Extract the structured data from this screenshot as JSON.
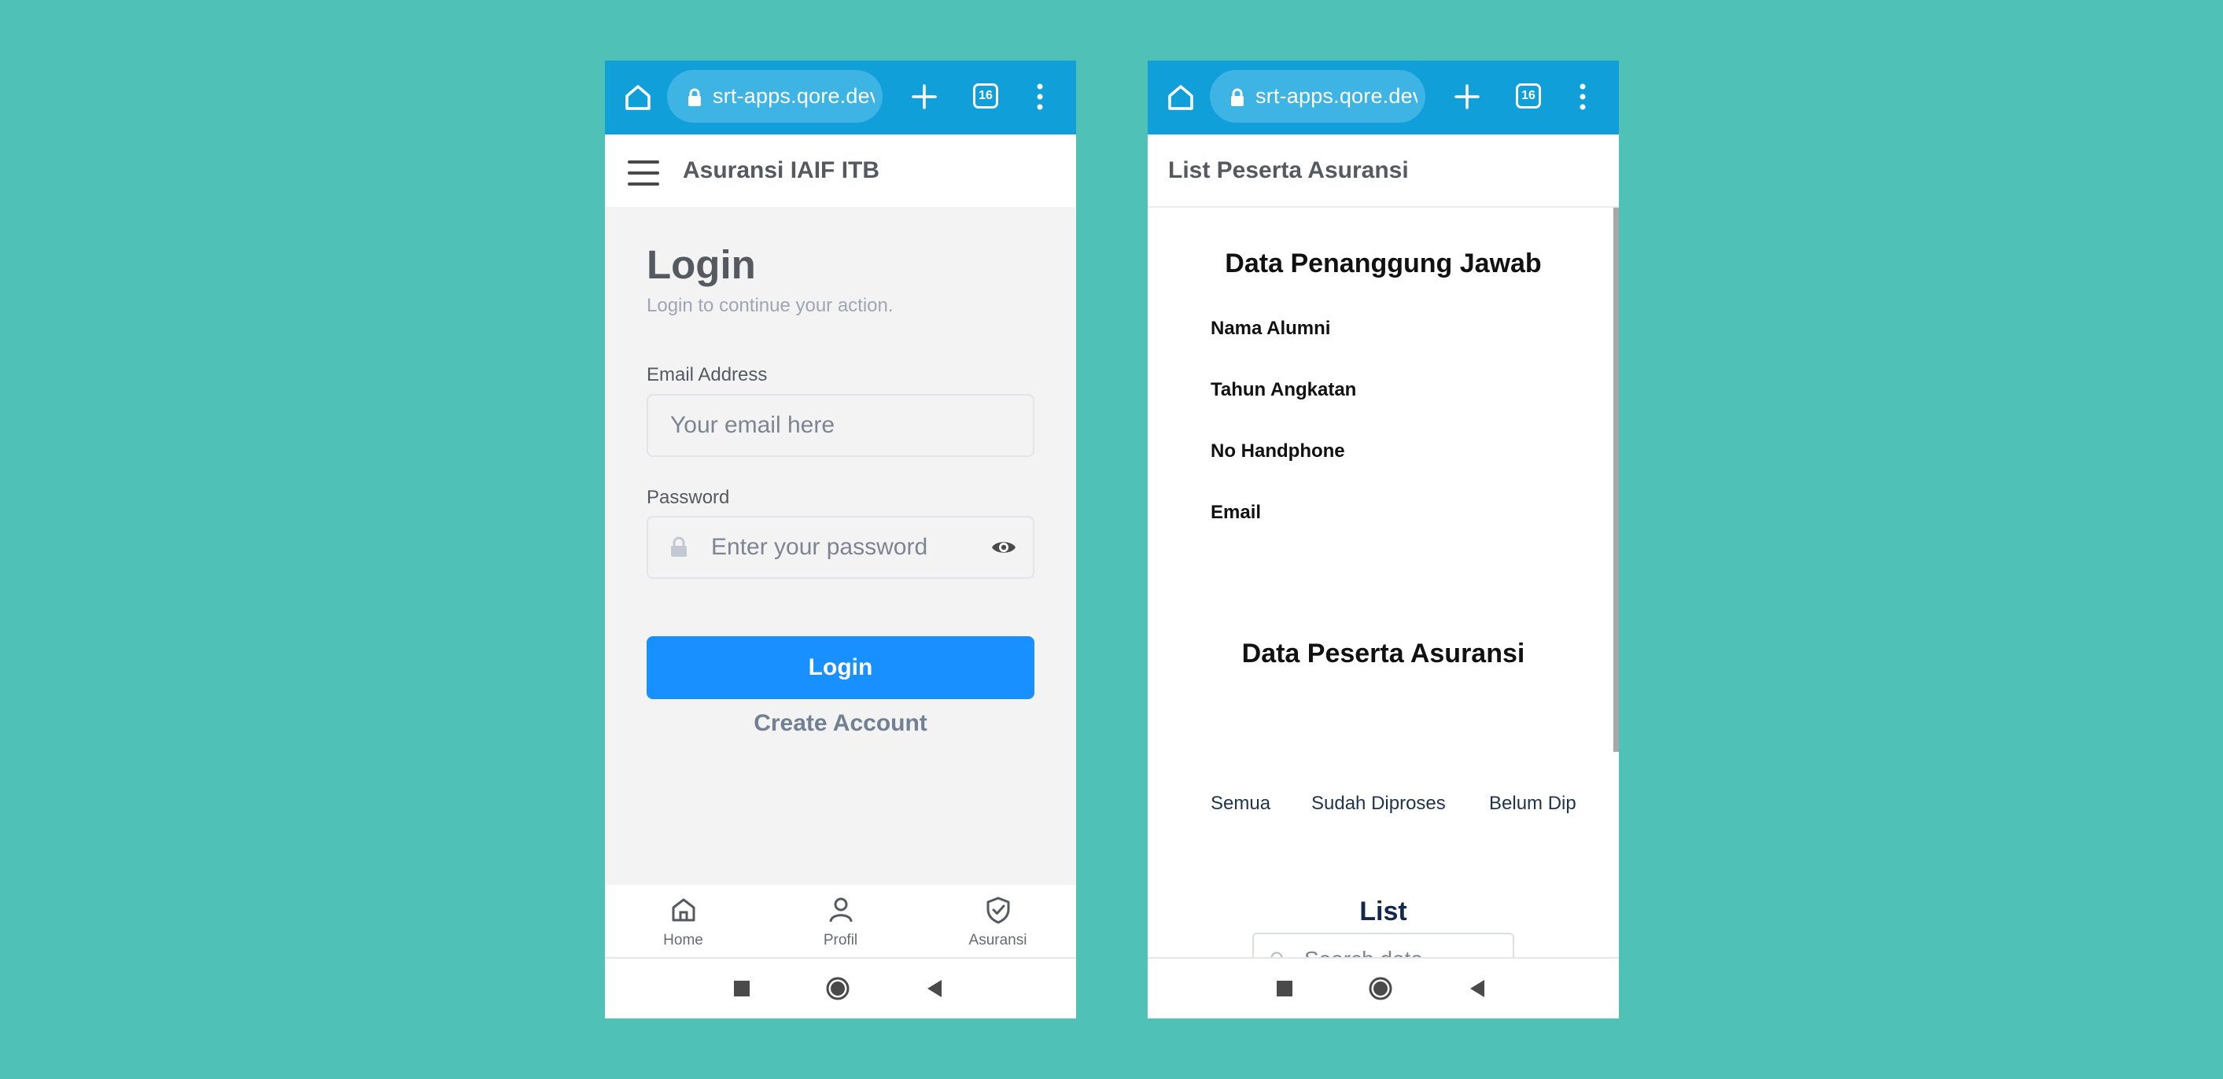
{
  "browser": {
    "url": "srt-apps.qore.dev",
    "tab_count": "16"
  },
  "login_screen": {
    "app_title": "Asuransi IAIF ITB",
    "title": "Login",
    "subtitle": "Login to continue your action.",
    "email_label": "Email Address",
    "email_placeholder": "Your email here",
    "password_label": "Password",
    "password_placeholder": "Enter your password",
    "login_button": "Login",
    "create_account": "Create Account",
    "bottom_nav": [
      {
        "label": "Home",
        "icon": "home-icon"
      },
      {
        "label": "Profil",
        "icon": "user-icon"
      },
      {
        "label": "Asuransi",
        "icon": "shield-check-icon"
      }
    ]
  },
  "list_screen": {
    "header_title": "List Peserta Asuransi",
    "section1_title": "Data Penanggung Jawab",
    "fields": [
      "Nama Alumni",
      "Tahun Angkatan",
      "No Handphone",
      "Email"
    ],
    "section2_title": "Data Peserta Asuransi",
    "filter_tabs": [
      "Semua",
      "Sudah Diproses",
      "Belum Dip"
    ],
    "list_title": "List",
    "search_placeholder": "Search data"
  },
  "colors": {
    "background": "#4fc1b7",
    "browser_bar": "#119fda",
    "primary_button": "#1890ff"
  }
}
